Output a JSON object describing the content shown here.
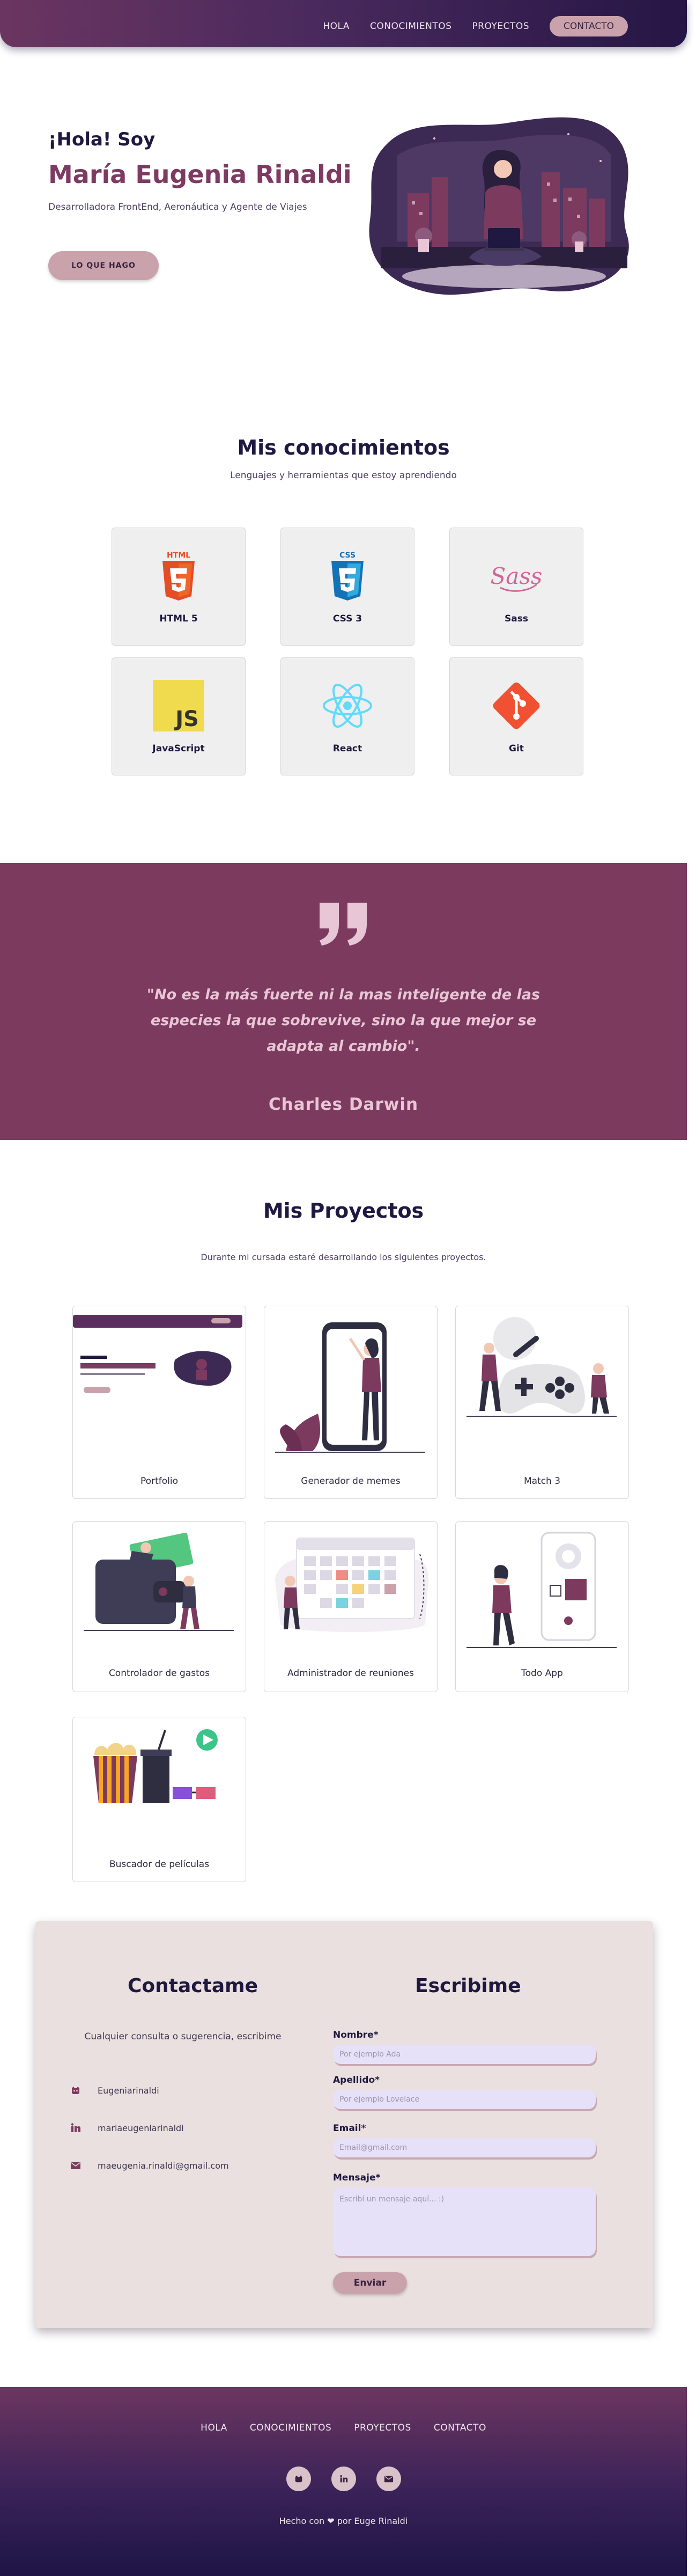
{
  "nav": {
    "links": [
      "HOLA",
      "CONOCIMIENTOS",
      "PROYECTOS"
    ],
    "cta": "CONTACTO"
  },
  "hero": {
    "greeting": "¡Hola! Soy",
    "name": "María Eugenia Rinaldi",
    "role": "Desarrolladora FrontEnd, Aeronáutica y Agente de Viajes",
    "button": "LO QUE HAGO"
  },
  "skills": {
    "title": "Mis conocimientos",
    "subtitle": "Lenguajes y herramientas que estoy aprendiendo",
    "items": [
      {
        "label": "HTML 5",
        "icon": "html5-icon"
      },
      {
        "label": "CSS 3",
        "icon": "css3-icon"
      },
      {
        "label": "Sass",
        "icon": "sass-icon"
      },
      {
        "label": "JavaScript",
        "icon": "javascript-icon"
      },
      {
        "label": "React",
        "icon": "react-icon"
      },
      {
        "label": "Git",
        "icon": "git-icon"
      }
    ]
  },
  "quote": {
    "text": "\"No es la más fuerte ni la mas inteligente de las especies la que sobrevive, sino la que mejor se adapta al cambio\".",
    "author": "Charles Darwin"
  },
  "projects": {
    "title": "Mis Proyectos",
    "subtitle": "Durante mi cursada estaré desarrollando los siguientes proyectos.",
    "items": [
      {
        "label": "Portfolio"
      },
      {
        "label": "Generador de memes"
      },
      {
        "label": "Match 3"
      },
      {
        "label": "Controlador de gastos"
      },
      {
        "label": "Administrador de reuniones"
      },
      {
        "label": "Todo App"
      },
      {
        "label": "Buscador de películas"
      }
    ]
  },
  "contact": {
    "title": "Contactame",
    "subtitle": "Cualquier consulta o sugerencia, escribime",
    "items": [
      {
        "icon": "github-icon",
        "text": "Eugeniarinaldi"
      },
      {
        "icon": "linkedin-icon",
        "text": "mariaeugenlarinaldi"
      },
      {
        "icon": "email-icon",
        "text": "maeugenia.rinaldi@gmail.com"
      }
    ],
    "form": {
      "title": "Escribime",
      "name_label": "Nombre*",
      "name_placeholder": "Por ejemplo Ada",
      "lastname_label": "Apellido*",
      "lastname_placeholder": "Por ejemplo Lovelace",
      "email_label": "Email*",
      "email_placeholder": "Email@gmail.com",
      "message_label": "Mensaje*",
      "message_placeholder": "Escribí un mensaje aquí... :)",
      "submit": "Enviar"
    }
  },
  "footer": {
    "links": [
      "HOLA",
      "CONOCIMIENTOS",
      "PROYECTOS",
      "CONTACTO"
    ],
    "credit_prefix": "Hecho con",
    "credit_suffix": "por Euge Rinaldi"
  },
  "colors": {
    "accent": "#7c3a5f",
    "button": "#c9a2ab",
    "dark": "#1f1840"
  }
}
